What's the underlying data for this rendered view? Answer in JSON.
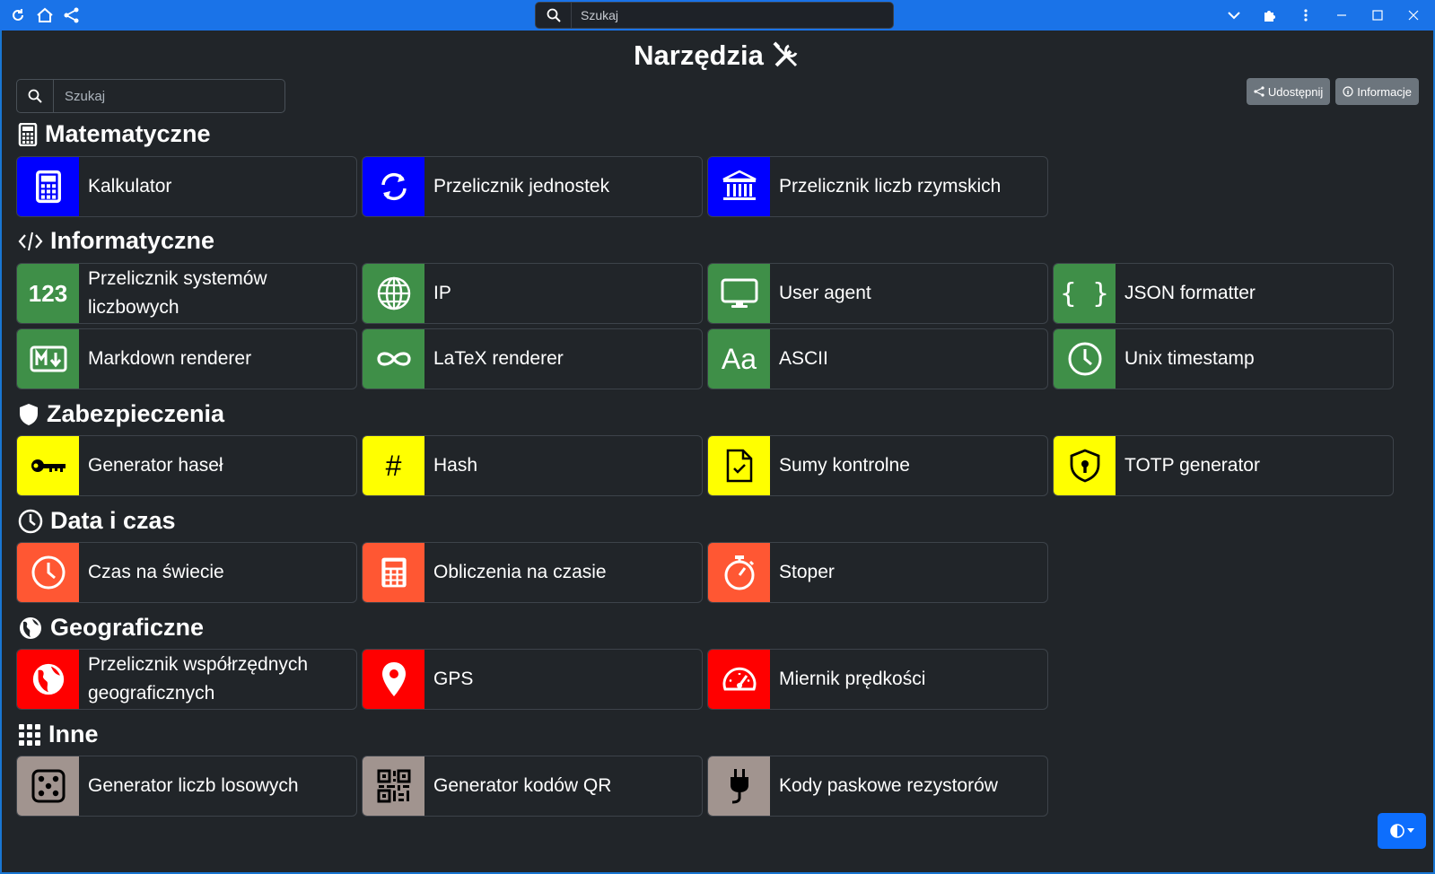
{
  "topbar": {
    "search_placeholder": "Szukaj"
  },
  "app": {
    "title": "Narzędzia",
    "search_placeholder": "Szukaj",
    "share_label": "Udostępnij",
    "info_label": "Informacje"
  },
  "sections": {
    "math": {
      "title": "Matematyczne",
      "items": [
        "Kalkulator",
        "Przelicznik jednostek",
        "Przelicznik liczb rzymskich"
      ]
    },
    "it": {
      "title": "Informatyczne",
      "items": [
        "Przelicznik systemów liczbowych",
        "IP",
        "User agent",
        "JSON formatter",
        "Markdown renderer",
        "LaTeX renderer",
        "ASCII",
        "Unix timestamp"
      ],
      "icon_texts": {
        "numbers": "123",
        "json": "{ }",
        "ascii": "Aa"
      }
    },
    "security": {
      "title": "Zabezpieczenia",
      "items": [
        "Generator haseł",
        "Hash",
        "Sumy kontrolne",
        "TOTP generator"
      ],
      "icon_texts": {
        "hash": "#"
      }
    },
    "datetime": {
      "title": "Data i czas",
      "items": [
        "Czas na świecie",
        "Obliczenia na czasie",
        "Stoper"
      ]
    },
    "geo": {
      "title": "Geograficzne",
      "items": [
        "Przelicznik współrzędnych geograficznych",
        "GPS",
        "Miernik prędkości"
      ]
    },
    "other": {
      "title": "Inne",
      "items": [
        "Generator liczb losowych",
        "Generator kodów QR",
        "Kody paskowe rezystorów"
      ]
    }
  },
  "colors": {
    "math": "#0000ff",
    "it": "#3f8f48",
    "security": "#ffff00",
    "datetime": "#ff5733",
    "geo": "#ff0000",
    "other": "#a1948f"
  }
}
